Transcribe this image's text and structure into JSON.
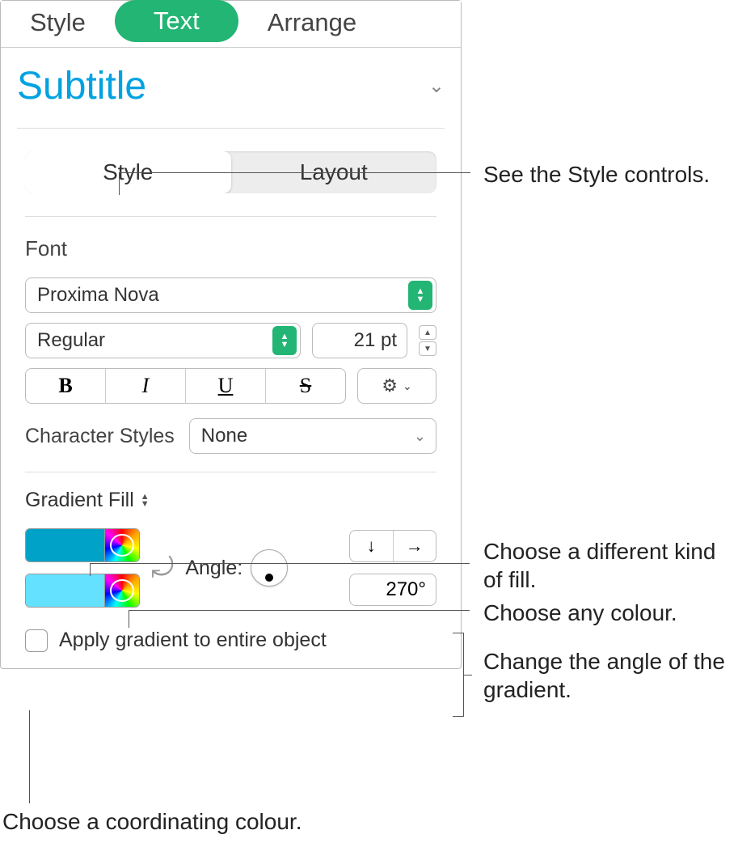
{
  "top_tabs": {
    "style": "Style",
    "text": "Text",
    "arrange": "Arrange"
  },
  "paragraph_style": {
    "name": "Subtitle"
  },
  "sub_tabs": {
    "style": "Style",
    "layout": "Layout"
  },
  "font": {
    "heading": "Font",
    "family": "Proxima Nova",
    "weight": "Regular",
    "size": "21 pt",
    "char_styles_label": "Character Styles",
    "char_styles_value": "None"
  },
  "gradient": {
    "title": "Gradient Fill",
    "color1": "#00a3c7",
    "color2": "#63e1ff",
    "angle_label": "Angle:",
    "angle_value": "270°",
    "apply_label": "Apply gradient to entire object"
  },
  "callouts": {
    "style_controls": "See the Style controls.",
    "fill_kind": "Choose a different kind of fill.",
    "any_colour": "Choose any colour.",
    "angle": "Change the angle of the gradient.",
    "coord_colour": "Choose a coordinating colour."
  }
}
